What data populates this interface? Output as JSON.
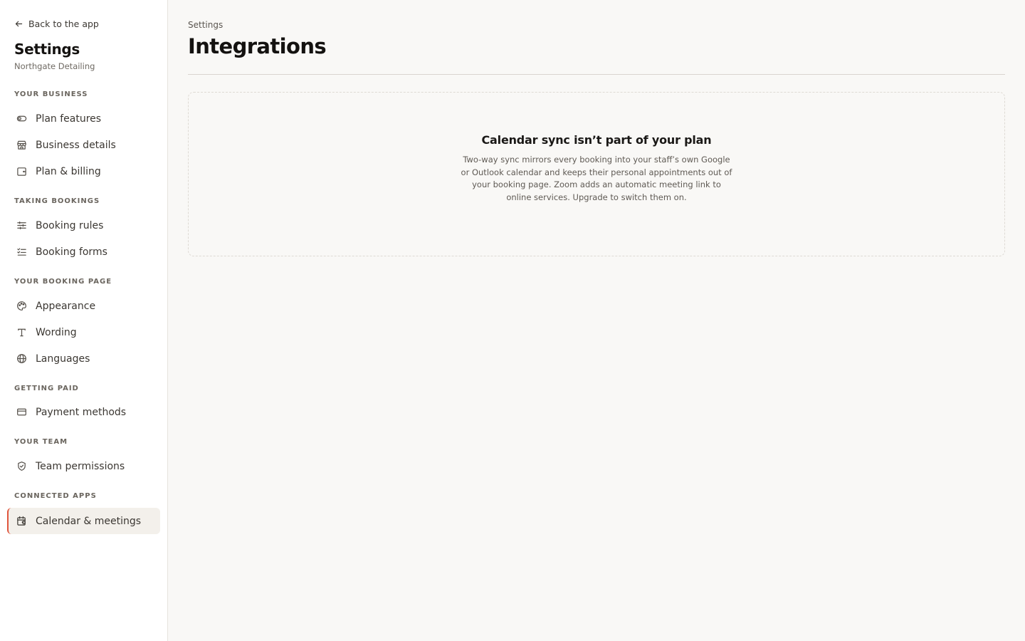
{
  "sidebar": {
    "back_label": "Back to the app",
    "title": "Settings",
    "business_name": "Northgate Detailing",
    "sections": [
      {
        "label": "YOUR BUSINESS",
        "items": [
          {
            "label": "Plan features",
            "icon": "toggle-icon"
          },
          {
            "label": "Business details",
            "icon": "store-icon"
          },
          {
            "label": "Plan & billing",
            "icon": "wallet-icon"
          }
        ]
      },
      {
        "label": "TAKING BOOKINGS",
        "items": [
          {
            "label": "Booking rules",
            "icon": "sliders-icon"
          },
          {
            "label": "Booking forms",
            "icon": "checklist-icon"
          }
        ]
      },
      {
        "label": "YOUR BOOKING PAGE",
        "items": [
          {
            "label": "Appearance",
            "icon": "palette-icon"
          },
          {
            "label": "Wording",
            "icon": "type-icon"
          },
          {
            "label": "Languages",
            "icon": "globe-icon"
          }
        ]
      },
      {
        "label": "GETTING PAID",
        "items": [
          {
            "label": "Payment methods",
            "icon": "credit-card-icon"
          }
        ]
      },
      {
        "label": "YOUR TEAM",
        "items": [
          {
            "label": "Team permissions",
            "icon": "shield-check-icon"
          }
        ]
      },
      {
        "label": "CONNECTED APPS",
        "items": [
          {
            "label": "Calendar & meetings",
            "icon": "calendar-sync-icon",
            "active": true
          }
        ]
      }
    ]
  },
  "main": {
    "breadcrumb": "Settings",
    "title": "Integrations",
    "empty_state": {
      "title": "Calendar sync isn’t part of your plan",
      "body": "Two-way sync mirrors every booking into your staff’s own Google or Outlook calendar and keeps their personal appointments out of your booking page. Zoom adds an automatic meeting link to online services. Upgrade to switch them on."
    }
  },
  "colors": {
    "accent": "#e0563d",
    "page_background": "#f9f8f6",
    "sidebar_background": "#ffffff",
    "active_item_background": "#f3f0eb"
  }
}
